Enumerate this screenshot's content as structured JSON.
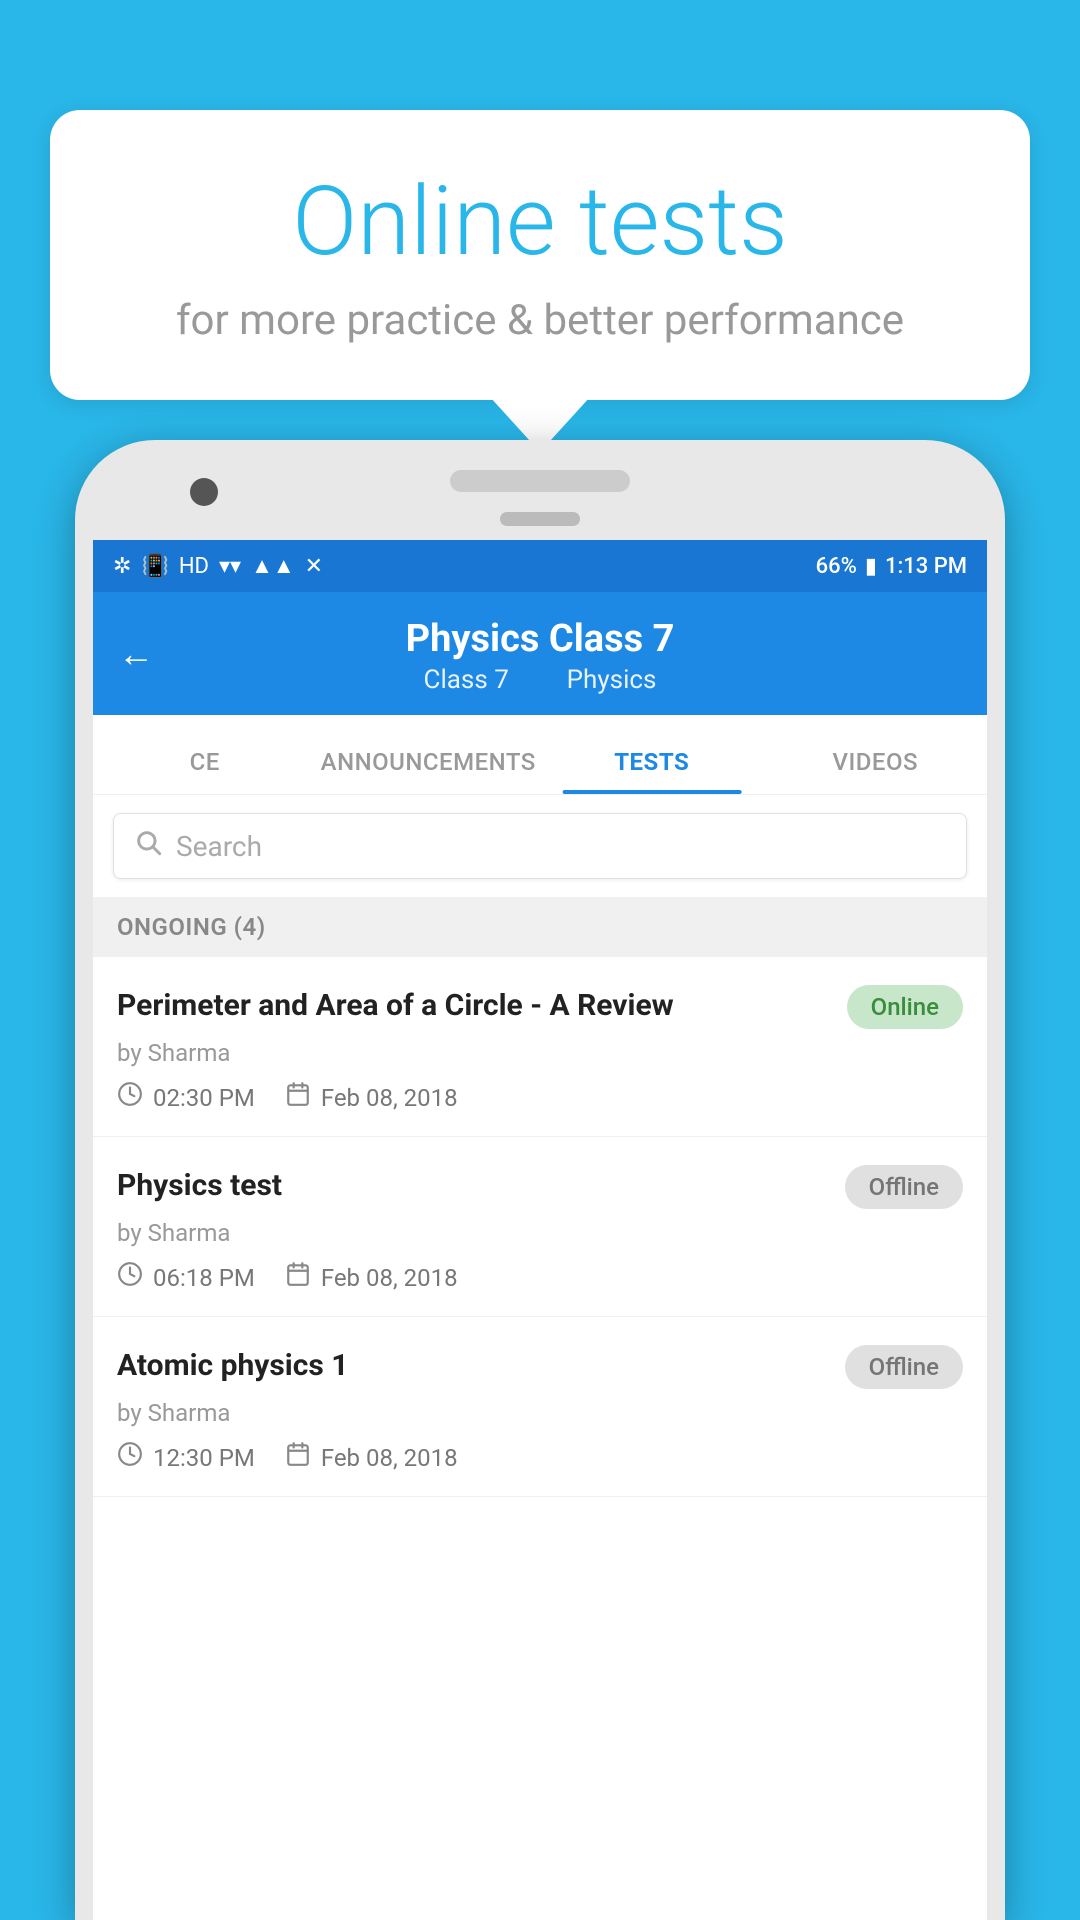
{
  "bubble": {
    "title": "Online tests",
    "subtitle": "for more practice & better performance"
  },
  "status_bar": {
    "battery": "66%",
    "time": "1:13 PM"
  },
  "header": {
    "title": "Physics Class 7",
    "subtitle_class": "Class 7",
    "subtitle_subject": "Physics",
    "back_label": "←"
  },
  "tabs": [
    {
      "label": "CE",
      "active": false
    },
    {
      "label": "ANNOUNCEMENTS",
      "active": false
    },
    {
      "label": "TESTS",
      "active": true
    },
    {
      "label": "VIDEOS",
      "active": false
    }
  ],
  "search": {
    "placeholder": "Search"
  },
  "section": {
    "label": "ONGOING (4)"
  },
  "tests": [
    {
      "title": "Perimeter and Area of a Circle - A Review",
      "author": "by Sharma",
      "time": "02:30 PM",
      "date": "Feb 08, 2018",
      "status": "Online",
      "status_type": "online"
    },
    {
      "title": "Physics test",
      "author": "by Sharma",
      "time": "06:18 PM",
      "date": "Feb 08, 2018",
      "status": "Offline",
      "status_type": "offline"
    },
    {
      "title": "Atomic physics 1",
      "author": "by Sharma",
      "time": "12:30 PM",
      "date": "Feb 08, 2018",
      "status": "Offline",
      "status_type": "offline"
    }
  ]
}
